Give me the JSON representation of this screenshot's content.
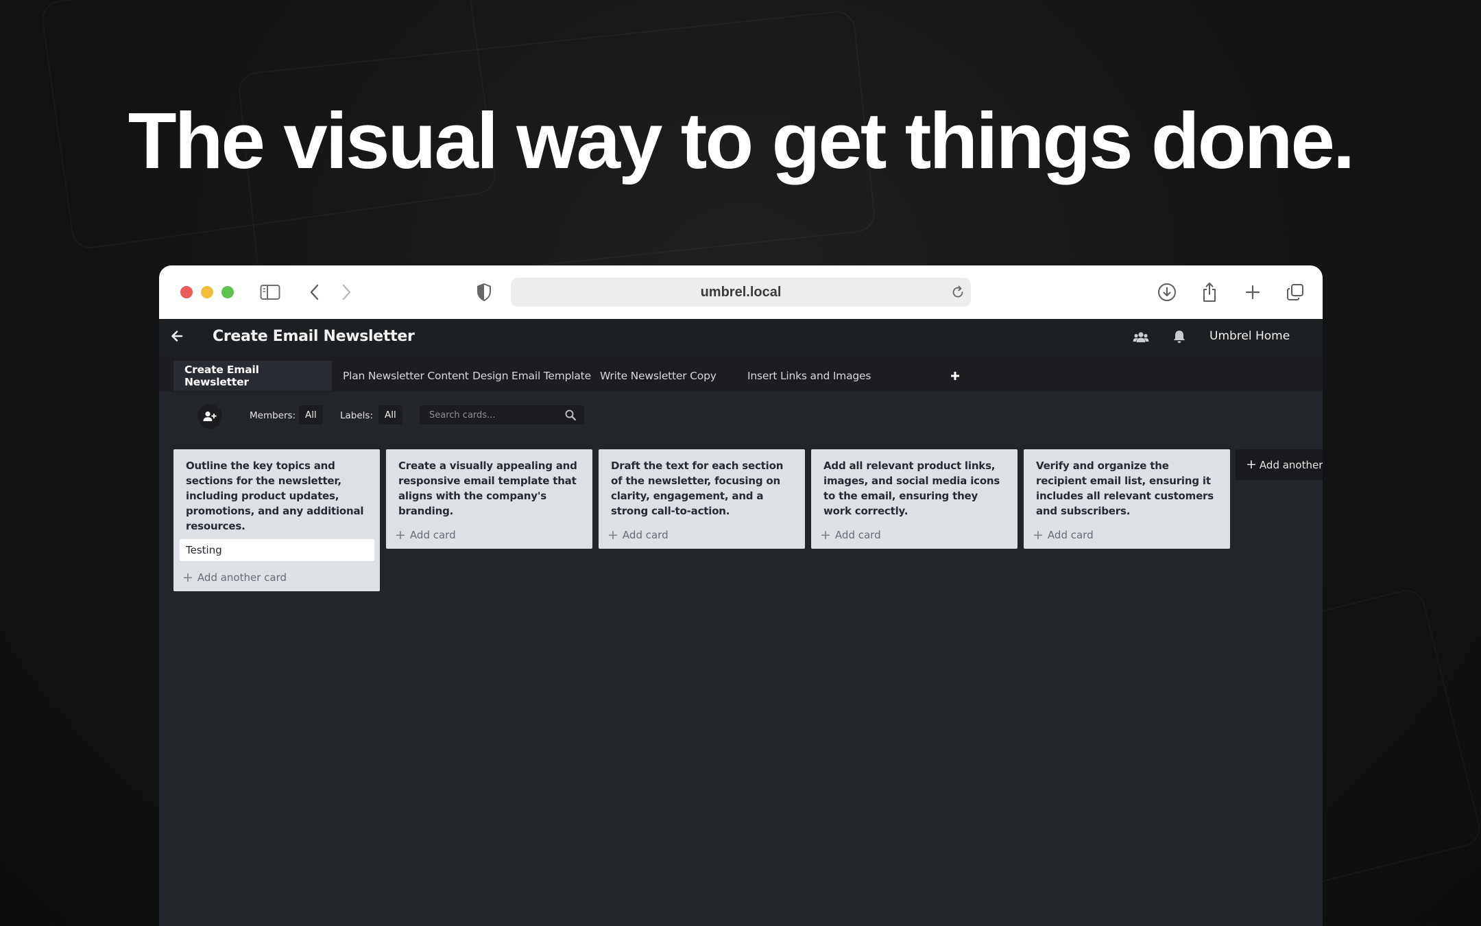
{
  "headline": "The visual way to get things done.",
  "browser": {
    "url": "umbrel.local"
  },
  "app": {
    "board_title": "Create Email Newsletter",
    "home_label": "Umbrel Home"
  },
  "tabs": [
    {
      "label": "Create Email Newsletter",
      "active": true
    },
    {
      "label": "Plan Newsletter Content",
      "active": false
    },
    {
      "label": "Design Email Template",
      "active": false
    },
    {
      "label": "Write Newsletter Copy",
      "active": false
    },
    {
      "label": "Insert Links and Images",
      "active": false
    }
  ],
  "filters": {
    "members_label": "Members:",
    "members_value": "All",
    "labels_label": "Labels:",
    "labels_value": "All",
    "search_placeholder": "Search cards..."
  },
  "lists": [
    {
      "text": "Outline the key topics and sections for the newsletter, including product updates, promotions, and any additional resources.",
      "cards": [
        "Testing"
      ],
      "add_label": "Add another card"
    },
    {
      "text": "Create a visually appealing and responsive email template that aligns with the company's branding.",
      "cards": [],
      "add_label": "Add card"
    },
    {
      "text": "Draft the text for each section of the newsletter, focusing on clarity, engagement, and a strong call-to-action.",
      "cards": [],
      "add_label": "Add card"
    },
    {
      "text": "Add all relevant product links, images, and social media icons to the email, ensuring they work correctly.",
      "cards": [],
      "add_label": "Add card"
    },
    {
      "text": "Verify and organize the recipient email list, ensuring it includes all relevant customers and subscribers.",
      "cards": [],
      "add_label": "Add card"
    }
  ],
  "add_list_label": "Add another",
  "colors": {
    "traffic_red": "#ec5f57",
    "traffic_yellow": "#f3bd3e",
    "traffic_green": "#5fc24f",
    "board_bg": "#22252a",
    "list_bg": "#dde0e4"
  }
}
